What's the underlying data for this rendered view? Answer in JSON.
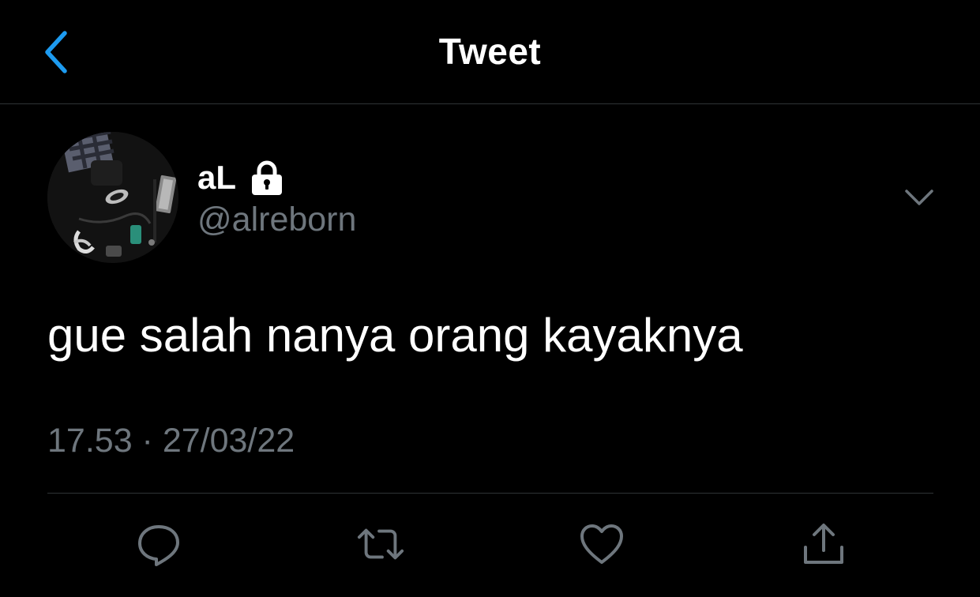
{
  "nav": {
    "title": "Tweet",
    "back_icon": "chevron-left-icon"
  },
  "tweet": {
    "author": {
      "display_name": "aL",
      "handle": "@alreborn",
      "protected_icon": "lock-icon"
    },
    "text": "gue salah nanya orang kayaknya",
    "timestamp": "17.53 · 27/03/22"
  },
  "actions": [
    {
      "icon": "reply-icon"
    },
    {
      "icon": "retweet-icon"
    },
    {
      "icon": "like-icon"
    },
    {
      "icon": "share-icon"
    }
  ],
  "colors": {
    "background": "#000000",
    "accent": "#1d9bf0",
    "secondary_text": "#6e767d",
    "divider": "#2f3336",
    "primary_text": "#ffffff"
  }
}
